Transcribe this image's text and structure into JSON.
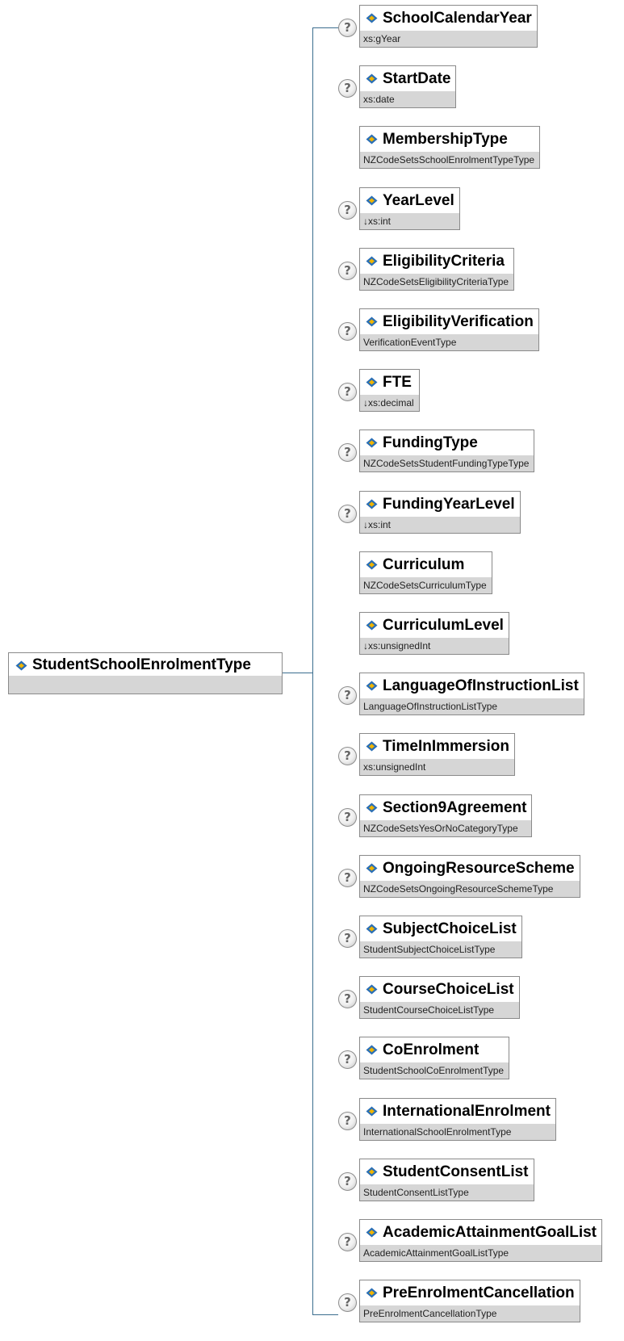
{
  "root": {
    "name": "StudentSchoolEnrolmentType"
  },
  "help_glyph": "?",
  "colors": {
    "connector": "#3b6d8e",
    "type_band": "#d6d6d6",
    "box_border": "#8a8a8a",
    "icon_blue": "#2b6fb5",
    "icon_yellow": "#f0b400"
  },
  "elements": [
    {
      "name": "SchoolCalendarYear",
      "type": "xs:gYear",
      "optional": true
    },
    {
      "name": "StartDate",
      "type": "xs:date",
      "optional": true
    },
    {
      "name": "MembershipType",
      "type": "NZCodeSetsSchoolEnrolmentTypeType",
      "optional": false
    },
    {
      "name": "YearLevel",
      "type": "↓xs:int",
      "optional": true
    },
    {
      "name": "EligibilityCriteria",
      "type": "NZCodeSetsEligibilityCriteriaType",
      "optional": true
    },
    {
      "name": "EligibilityVerification",
      "type": "VerificationEventType",
      "optional": true
    },
    {
      "name": "FTE",
      "type": "↓xs:decimal",
      "optional": true
    },
    {
      "name": "FundingType",
      "type": "NZCodeSetsStudentFundingTypeType",
      "optional": true
    },
    {
      "name": "FundingYearLevel",
      "type": "↓xs:int",
      "optional": true
    },
    {
      "name": "Curriculum",
      "type": "NZCodeSetsCurriculumType",
      "optional": false
    },
    {
      "name": "CurriculumLevel",
      "type": "↓xs:unsignedInt",
      "optional": false
    },
    {
      "name": "LanguageOfInstructionList",
      "type": "LanguageOfInstructionListType",
      "optional": true
    },
    {
      "name": "TimeInImmersion",
      "type": "xs:unsignedInt",
      "optional": true
    },
    {
      "name": "Section9Agreement",
      "type": "NZCodeSetsYesOrNoCategoryType",
      "optional": true
    },
    {
      "name": "OngoingResourceScheme",
      "type": "NZCodeSetsOngoingResourceSchemeType",
      "optional": true
    },
    {
      "name": "SubjectChoiceList",
      "type": "StudentSubjectChoiceListType",
      "optional": true
    },
    {
      "name": "CourseChoiceList",
      "type": "StudentCourseChoiceListType",
      "optional": true
    },
    {
      "name": "CoEnrolment",
      "type": "StudentSchoolCoEnrolmentType",
      "optional": true
    },
    {
      "name": "InternationalEnrolment",
      "type": "InternationalSchoolEnrolmentType",
      "optional": true
    },
    {
      "name": "StudentConsentList",
      "type": "StudentConsentListType",
      "optional": true
    },
    {
      "name": "AcademicAttainmentGoalList",
      "type": "AcademicAttainmentGoalListType",
      "optional": true
    },
    {
      "name": "PreEnrolmentCancellation",
      "type": "PreEnrolmentCancellationType",
      "optional": true
    }
  ]
}
